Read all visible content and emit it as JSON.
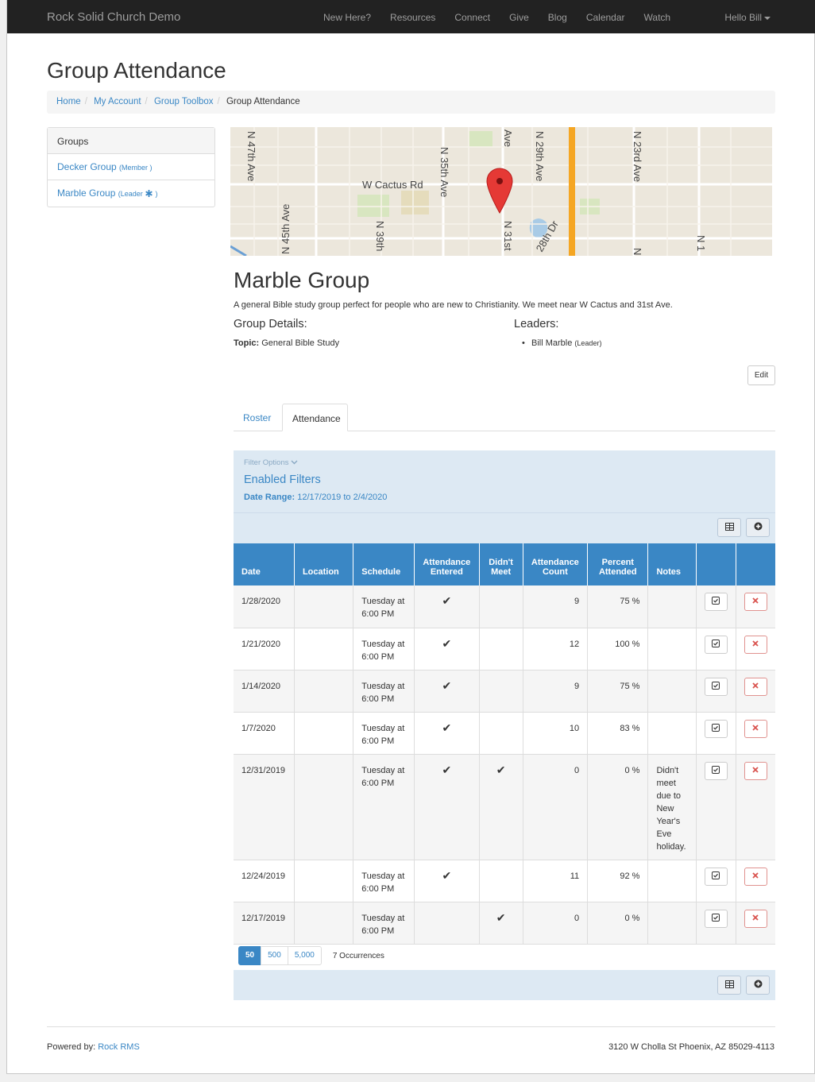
{
  "nav": {
    "brand": "Rock Solid Church Demo",
    "links": [
      "New Here?",
      "Resources",
      "Connect",
      "Give",
      "Blog",
      "Calendar",
      "Watch"
    ],
    "user": "Hello Bill"
  },
  "page": {
    "title": "Group Attendance"
  },
  "breadcrumb": {
    "items": [
      "Home",
      "My Account",
      "Group Toolbox"
    ],
    "active": "Group Attendance"
  },
  "sidebar": {
    "title": "Groups",
    "items": [
      {
        "name": "Decker Group",
        "role": "(Member )"
      },
      {
        "name": "Marble Group",
        "role": "(Leader",
        "role_end": ")"
      }
    ]
  },
  "map": {
    "labels": [
      "W Cactus Rd",
      "N 47th Ave",
      "N 45th Ave",
      "N 39th",
      "N 35th Ave",
      "Ave",
      "N 31st",
      "28th Dr",
      "N 29th Ave",
      "N 23rd Ave",
      "N",
      "N 1"
    ]
  },
  "group": {
    "name": "Marble Group",
    "description": "A general Bible study group perfect for people who are new to Christianity. We meet near W Cactus and 31st Ave.",
    "details_heading": "Group Details:",
    "leaders_heading": "Leaders:",
    "topic_label": "Topic:",
    "topic_value": "General Bible Study",
    "leader_name": "Bill Marble",
    "leader_role": "(Leader)",
    "edit_label": "Edit"
  },
  "tabs": [
    "Roster",
    "Attendance"
  ],
  "filter": {
    "options_label": "Filter Options",
    "enabled_label": "Enabled Filters",
    "date_range_label": "Date Range:",
    "date_range_value": "12/17/2019 to 2/4/2020"
  },
  "table": {
    "headers": [
      "Date",
      "Location",
      "Schedule",
      "Attendance Entered",
      "Didn't Meet",
      "Attendance Count",
      "Percent Attended",
      "Notes"
    ],
    "rows": [
      {
        "date": "1/28/2020",
        "location": "",
        "schedule": "Tuesday at 6:00 PM",
        "entered": "✔",
        "didnt_meet": "",
        "count": "9",
        "percent": "75 %",
        "notes": ""
      },
      {
        "date": "1/21/2020",
        "location": "",
        "schedule": "Tuesday at 6:00 PM",
        "entered": "✔",
        "didnt_meet": "",
        "count": "12",
        "percent": "100 %",
        "notes": ""
      },
      {
        "date": "1/14/2020",
        "location": "",
        "schedule": "Tuesday at 6:00 PM",
        "entered": "✔",
        "didnt_meet": "",
        "count": "9",
        "percent": "75 %",
        "notes": ""
      },
      {
        "date": "1/7/2020",
        "location": "",
        "schedule": "Tuesday at 6:00 PM",
        "entered": "✔",
        "didnt_meet": "",
        "count": "10",
        "percent": "83 %",
        "notes": ""
      },
      {
        "date": "12/31/2019",
        "location": "",
        "schedule": "Tuesday at 6:00 PM",
        "entered": "✔",
        "didnt_meet": "✔",
        "count": "0",
        "percent": "0 %",
        "notes": "Didn't meet due to New Year's Eve holiday."
      },
      {
        "date": "12/24/2019",
        "location": "",
        "schedule": "Tuesday at 6:00 PM",
        "entered": "✔",
        "didnt_meet": "",
        "count": "11",
        "percent": "92 %",
        "notes": ""
      },
      {
        "date": "12/17/2019",
        "location": "",
        "schedule": "Tuesday at 6:00 PM",
        "entered": "",
        "didnt_meet": "✔",
        "count": "0",
        "percent": "0 %",
        "notes": ""
      }
    ]
  },
  "pager": {
    "sizes": [
      "50",
      "500",
      "5,000"
    ],
    "occurrences": "7 Occurrences"
  },
  "footer": {
    "powered_label": "Powered by:",
    "powered_link": "Rock RMS",
    "address": "3120 W Cholla St Phoenix, AZ 85029-4113"
  },
  "icons": {
    "grid_export": "table-icon",
    "add": "plus-circle-icon",
    "row_edit": "check-square-icon",
    "row_delete": "x-icon"
  },
  "colors": {
    "accent": "#3a87c5",
    "danger": "#d9534f",
    "navbar": "#222222",
    "filter_bg": "#dde9f3"
  }
}
